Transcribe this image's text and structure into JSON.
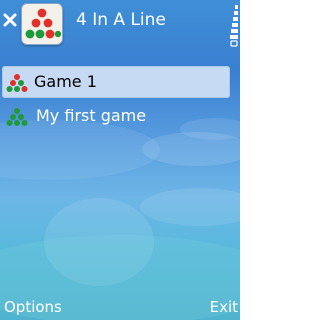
{
  "app": {
    "title": "4 In A Line"
  },
  "icons": {
    "close": "close-icon",
    "app": "four-in-a-line-app-icon",
    "signal": "signal-strength-icon",
    "game": "game-pieces-icon"
  },
  "list": {
    "items": [
      {
        "label": "Game 1",
        "selected": true
      },
      {
        "label": "My first game",
        "selected": false
      }
    ]
  },
  "softkeys": {
    "left": "Options",
    "right": "Exit"
  },
  "colors": {
    "selection": "#c7daf3",
    "piece_red": "#e0302a",
    "piece_green": "#1f9a3a"
  }
}
